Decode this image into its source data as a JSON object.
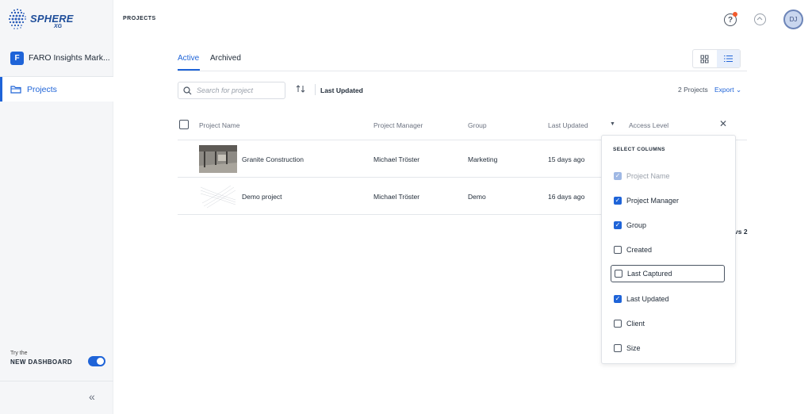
{
  "app": {
    "logo_text": "SPHERE",
    "logo_sub": "XG"
  },
  "sidebar": {
    "org_initial": "F",
    "org_name": "FARO Insights Mark...",
    "nav_projects": "Projects",
    "try_label": "Try the",
    "new_dashboard_label": "NEW DASHBOARD",
    "new_dashboard_enabled": true
  },
  "header": {
    "breadcrumb": "PROJECTS",
    "help_glyph": "?",
    "avatar_initials": "DJ"
  },
  "tabs": [
    {
      "label": "Active",
      "active": true
    },
    {
      "label": "Archived",
      "active": false
    }
  ],
  "toolbar": {
    "search_placeholder": "Search for project",
    "sort_label": "Last Updated",
    "project_count": "2 Projects",
    "export_label": "Export"
  },
  "table": {
    "headers": [
      "Project Name",
      "Project Manager",
      "Group",
      "Last Updated",
      "Access Level"
    ],
    "rows": [
      {
        "name": "Granite Construction",
        "manager": "Michael Tröster",
        "group": "Marketing",
        "updated": "15 days ago"
      },
      {
        "name": "Demo project",
        "manager": "Michael Tröster",
        "group": "Demo",
        "updated": "16 days ago"
      }
    ],
    "partial_text": "vs 2"
  },
  "column_picker": {
    "title": "SELECT COLUMNS",
    "options": [
      {
        "label": "Project Name",
        "checked": true,
        "disabled": true
      },
      {
        "label": "Project Manager",
        "checked": true,
        "disabled": false
      },
      {
        "label": "Group",
        "checked": true,
        "disabled": false
      },
      {
        "label": "Created",
        "checked": false,
        "disabled": false
      },
      {
        "label": "Last Captured",
        "checked": false,
        "disabled": false,
        "focused": true
      },
      {
        "label": "Last Updated",
        "checked": true,
        "disabled": false
      },
      {
        "label": "Client",
        "checked": false,
        "disabled": false
      },
      {
        "label": "Size",
        "checked": false,
        "disabled": false
      }
    ]
  },
  "colors": {
    "accent": "#1f64d8",
    "notification": "#f25a2c"
  }
}
